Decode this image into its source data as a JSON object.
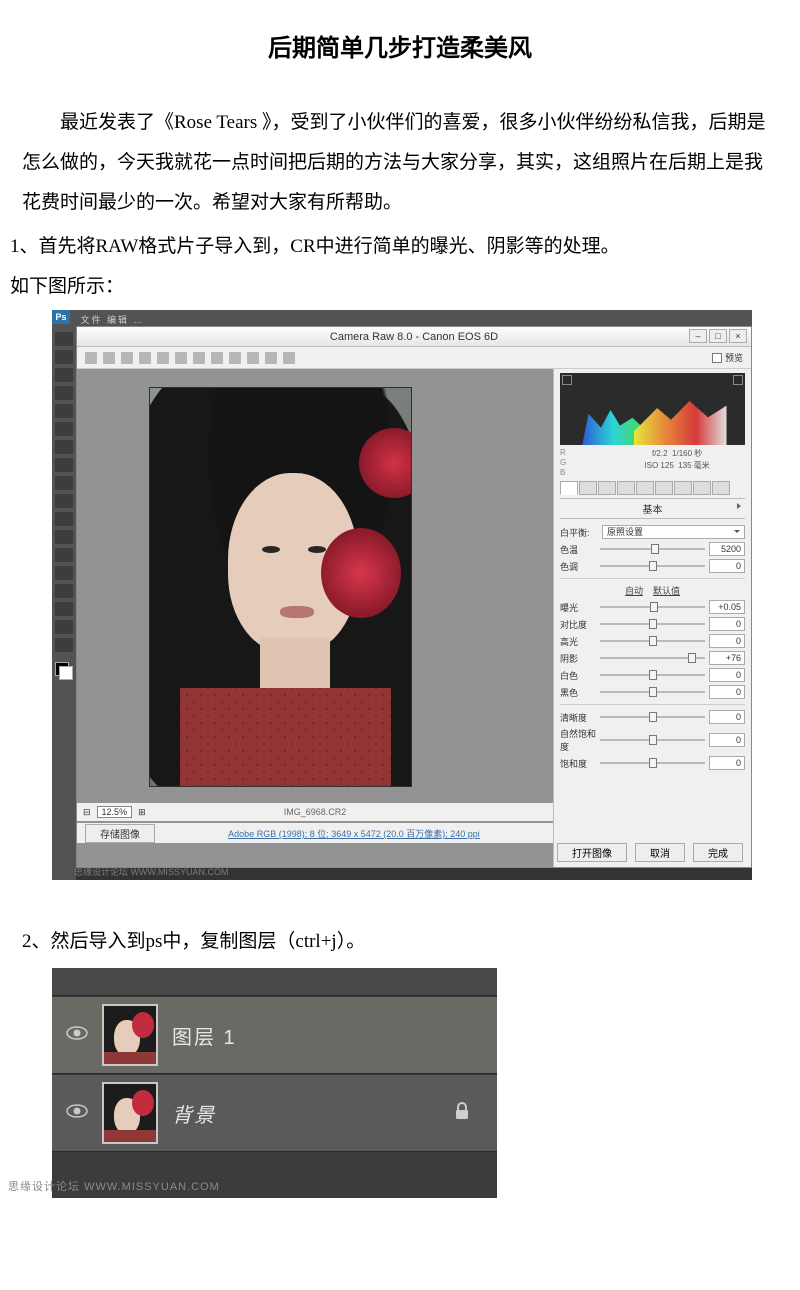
{
  "article": {
    "title": "后期简单几步打造柔美风",
    "intro": "最近发表了《Rose Tears 》，受到了小伙伴们的喜爱，很多小伙伴纷纷私信我，后期是怎么做的，今天我就花一点时间把后期的方法与大家分享，其实，这组照片在后期上是我花费时间最少的一次。希望对大家有所帮助。",
    "step1_line1": "1、首先将RAW格式片子导入到，CR中进行简单的曝光、阴影等的处理。",
    "step1_line2": "如下图所示：",
    "step2": "2、然后导入到ps中，复制图层（ctrl+j）。"
  },
  "camera_raw": {
    "window_title": "Camera Raw 8.0  -  Canon EOS 6D",
    "preview_label": "预览",
    "zoom": "12.5%",
    "filename": "IMG_6968.CR2",
    "save_image": "存储图像",
    "color_info": "Adobe RGB (1998); 8 位; 3649 x 5472 (20.0 百万像素); 240 ppi",
    "exif": {
      "aperture": "f/2.2",
      "shutter": "1/160 秒",
      "iso": "ISO 125",
      "focal": "135 毫米"
    },
    "panel_title": "基本",
    "wb_label": "白平衡:",
    "wb_value": "原照设置",
    "auto_label": "自动",
    "default_label": "默认值",
    "sliders": {
      "temperature": {
        "label": "色温",
        "value": "5200",
        "pos": 52
      },
      "tint": {
        "label": "色调",
        "value": "0",
        "pos": 50
      },
      "exposure": {
        "label": "曝光",
        "value": "+0.05",
        "pos": 51
      },
      "contrast": {
        "label": "对比度",
        "value": "0",
        "pos": 50
      },
      "highlights": {
        "label": "高光",
        "value": "0",
        "pos": 50
      },
      "shadows": {
        "label": "阴影",
        "value": "+76",
        "pos": 88
      },
      "whites": {
        "label": "白色",
        "value": "0",
        "pos": 50
      },
      "blacks": {
        "label": "黑色",
        "value": "0",
        "pos": 50
      },
      "clarity": {
        "label": "清晰度",
        "value": "0",
        "pos": 50
      },
      "vibrance": {
        "label": "自然饱和度",
        "value": "0",
        "pos": 50
      },
      "saturation": {
        "label": "饱和度",
        "value": "0",
        "pos": 50
      }
    },
    "buttons": {
      "open": "打开图像",
      "cancel": "取消",
      "done": "完成"
    }
  },
  "layers": {
    "layer1": "图层 1",
    "background": "背景"
  },
  "footer": "思缘设计论坛   WWW.MISSYUAN.COM"
}
